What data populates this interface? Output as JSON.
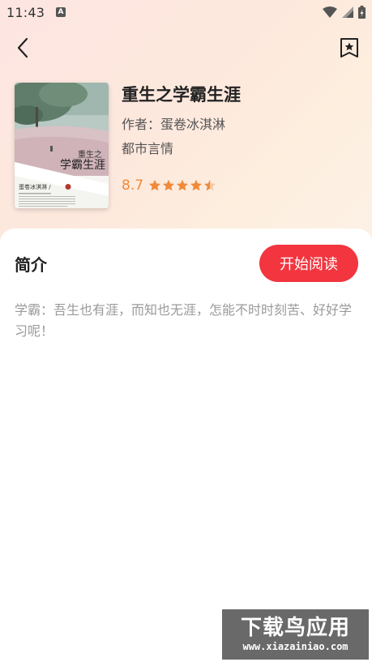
{
  "status_bar": {
    "time": "11:43",
    "icons": [
      "notification-a-icon",
      "wifi-icon",
      "signal-icon",
      "battery-icon"
    ]
  },
  "nav": {
    "back_icon": "chevron-left-icon",
    "bookmark_icon": "bookmark-star-icon"
  },
  "book": {
    "title": "重生之学霸生涯",
    "author": "作者：蛋卷冰淇淋",
    "category": "都市言情",
    "rating": "8.7",
    "rating_stars": 4.5,
    "cover": {
      "title_line1": "重生之",
      "title_line2": "学霸生涯",
      "author_caption": "蛋卷冰淇淋 / ",
      "badge": "著"
    }
  },
  "intro": {
    "section_title": "简介",
    "read_button_label": "开始阅读",
    "text": "学霸：吾生也有涯，而知也无涯，怎能不时时刻苦、好好学习呢！"
  },
  "watermark": {
    "main": "下载鸟应用",
    "sub": "www.xiazainiao.com"
  },
  "colors": {
    "accent": "#f2353f",
    "rating": "#f08a3a",
    "intro_text": "#9a9a9a"
  }
}
